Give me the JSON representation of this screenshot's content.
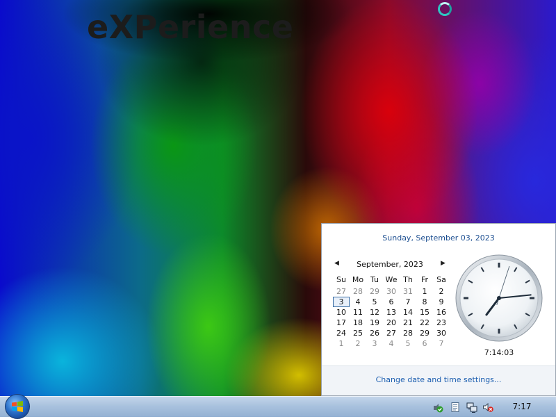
{
  "desktop": {
    "watermark": "eXPerience"
  },
  "flyout": {
    "long_date": "Sunday, September 03, 2023",
    "calendar": {
      "title": "September, 2023",
      "prev_icon": "triangle-left-icon",
      "next_icon": "triangle-right-icon",
      "day_headers": [
        "Su",
        "Mo",
        "Tu",
        "We",
        "Th",
        "Fr",
        "Sa"
      ],
      "weeks": [
        [
          "27",
          "28",
          "29",
          "30",
          "31",
          "1",
          "2"
        ],
        [
          "3",
          "4",
          "5",
          "6",
          "7",
          "8",
          "9"
        ],
        [
          "10",
          "11",
          "12",
          "13",
          "14",
          "15",
          "16"
        ],
        [
          "17",
          "18",
          "19",
          "20",
          "21",
          "22",
          "23"
        ],
        [
          "24",
          "25",
          "26",
          "27",
          "28",
          "29",
          "30"
        ],
        [
          "1",
          "2",
          "3",
          "4",
          "5",
          "6",
          "7"
        ]
      ],
      "selected_day": "3"
    },
    "clock": {
      "hours": 7,
      "minutes": 14,
      "seconds": 3
    },
    "time_text": "7:14:03",
    "change_link": "Change date and time settings..."
  },
  "taskbar": {
    "start_icon": "windows-logo-icon",
    "tray_icons": [
      "action-center-icon",
      "document-icon",
      "network-icon",
      "volume-muted-icon"
    ],
    "time": "7:17"
  },
  "colors": {
    "link_blue": "#1d5fb0",
    "date_blue": "#1d4f91",
    "taskbar": "#a9c2de"
  }
}
